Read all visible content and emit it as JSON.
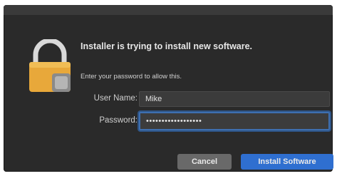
{
  "dialog": {
    "headline": "Installer is trying to install new software.",
    "subtext": "Enter your password to allow this.",
    "icon": "lock-icon"
  },
  "form": {
    "username_label": "User Name:",
    "username_value": "Mike",
    "password_label": "Password:",
    "password_value": "••••••••••••••••••"
  },
  "buttons": {
    "cancel_label": "Cancel",
    "install_label": "Install Software"
  },
  "colors": {
    "dialog_bg": "#2a2a2a",
    "accent": "#2f6fd0",
    "lock_gold": "#e8a83a"
  }
}
